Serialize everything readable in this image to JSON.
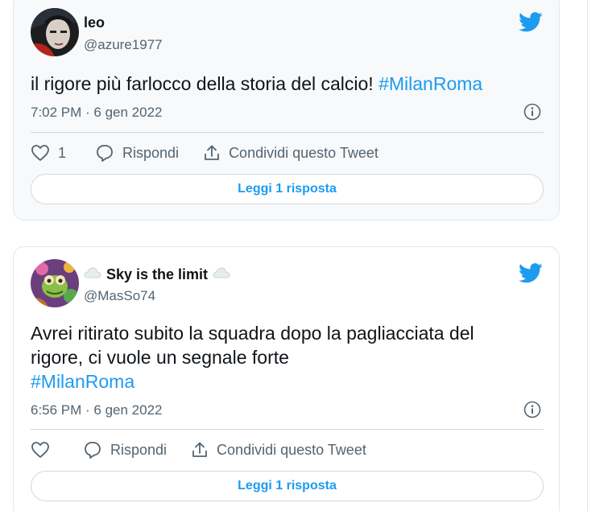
{
  "tweets": [
    {
      "display_name": "leo",
      "handle": "@azure1977",
      "text_main": "il rigore più farlocco della storia del calcio! ",
      "hashtag": "#MilanRoma",
      "timestamp": "7:02 PM · 6 gen 2022",
      "like_count": "1",
      "reply_label": "Rispondi",
      "share_label": "Condividi questo Tweet",
      "read_reply_label": "Leggi 1 risposta"
    },
    {
      "display_name": "Sky is the limit",
      "name_prefix_emoji": "cloud-icon",
      "name_suffix_emoji": "cloud-icon",
      "handle": "@MasSo74",
      "text_line1": "Avrei ritirato subito la squadra dopo la pagliacciata del",
      "text_line2": "rigore, ci vuole un segnale forte",
      "hashtag": "#MilanRoma",
      "timestamp": "6:56 PM · 6 gen 2022",
      "reply_label": "Rispondi",
      "share_label": "Condividi questo Tweet",
      "read_reply_label": "Leggi 1 risposta"
    }
  ],
  "colors": {
    "accent": "#1d9bf0",
    "text": "#0f1419",
    "secondary": "#536471",
    "border": "#cfd9de"
  },
  "icons": [
    "twitter-bird-icon",
    "info-icon",
    "heart-icon",
    "reply-icon",
    "share-icon",
    "cloud-icon"
  ]
}
